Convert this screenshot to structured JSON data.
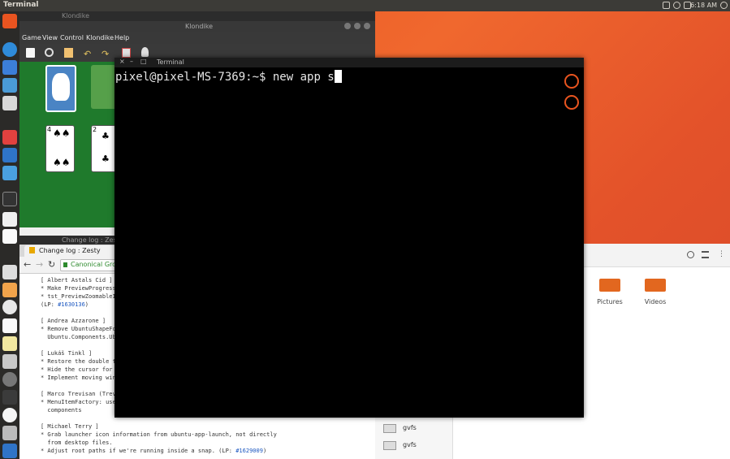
{
  "panel": {
    "title": "Terminal",
    "clock": "6:18 AM"
  },
  "klondike": {
    "outer_title": "Klondike",
    "title": "Klondike",
    "menu": [
      "Game",
      "View",
      "Control",
      "Klondike",
      "Help"
    ],
    "cards": {
      "a_top": "4",
      "b_top": "2"
    }
  },
  "terminal": {
    "title": "Terminal",
    "prompt": "pixel@pixel-MS-7369:~$ ",
    "command": "new app s"
  },
  "browser": {
    "window_title": "Change log : Zesty",
    "tab_label": "Change log : Zesty",
    "tab_close": "×",
    "address": "Canonical Gro",
    "changelog": [
      {
        "text": "[ Albert Astals Cid ]"
      },
      {
        "text": "* Make PreviewProgress b"
      },
      {
        "text": "* tst_PreviewZoomableIma"
      },
      {
        "text": "(LP: ",
        "link": "#1630136",
        "after": ")"
      },
      {
        "text": ""
      },
      {
        "text": "[ Andrea Azzarone ]"
      },
      {
        "text": "* Remove UbuntuShapeForI"
      },
      {
        "text": "  Ubuntu.Components.Ubun"
      },
      {
        "text": ""
      },
      {
        "text": "[ Lukáš Tinkl ]"
      },
      {
        "text": "* Restore the double tap"
      },
      {
        "text": "* Hide the cursor for fu"
      },
      {
        "text": "* Implement moving windo"
      },
      {
        "text": ""
      },
      {
        "text": "[ Marco Trevisan (Trevi"
      },
      {
        "text": "* MenuItemFactory: use m"
      },
      {
        "text": "  components"
      },
      {
        "text": ""
      },
      {
        "text": "[ Michael Terry ]"
      },
      {
        "text": "* Grab launcher icon information from ubuntu-app-launch, not directly"
      },
      {
        "text": "  from desktop files."
      },
      {
        "text": "* Adjust root paths if we're running inside a snap. (LP: ",
        "link": "#1629009",
        "after": ")"
      }
    ]
  },
  "files": {
    "folders": [
      "Pictures",
      "Videos"
    ],
    "drives": [
      "gvfs",
      "gvfs"
    ]
  }
}
